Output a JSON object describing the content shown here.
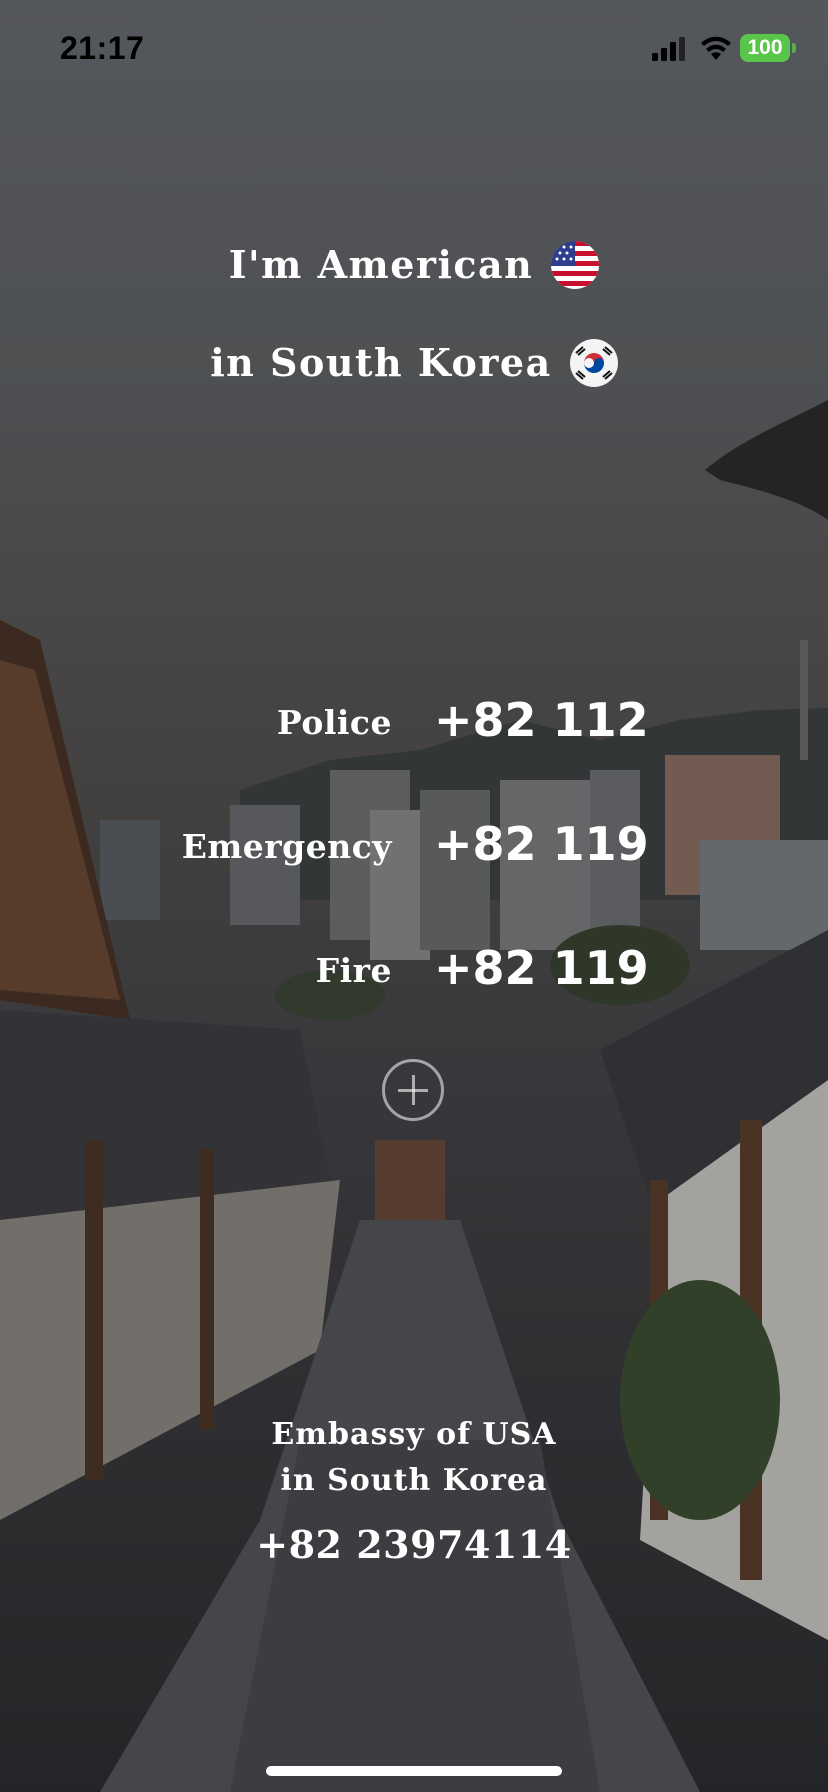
{
  "status_bar": {
    "time": "21:17",
    "battery": "100"
  },
  "header": {
    "nationality": "I'm American",
    "location": "in South Korea"
  },
  "numbers": [
    {
      "label": "Police",
      "number": "+82 112"
    },
    {
      "label": "Emergency",
      "number": "+82 119"
    },
    {
      "label": "Fire",
      "number": "+82 119"
    }
  ],
  "embassy": {
    "line1": "Embassy of USA",
    "line2": "in South Korea",
    "number": "+82 23974114"
  },
  "icons": [
    "cellular-signal-icon",
    "wifi-icon",
    "battery-icon",
    "us-flag-icon",
    "south-korea-flag-icon",
    "add-icon"
  ]
}
